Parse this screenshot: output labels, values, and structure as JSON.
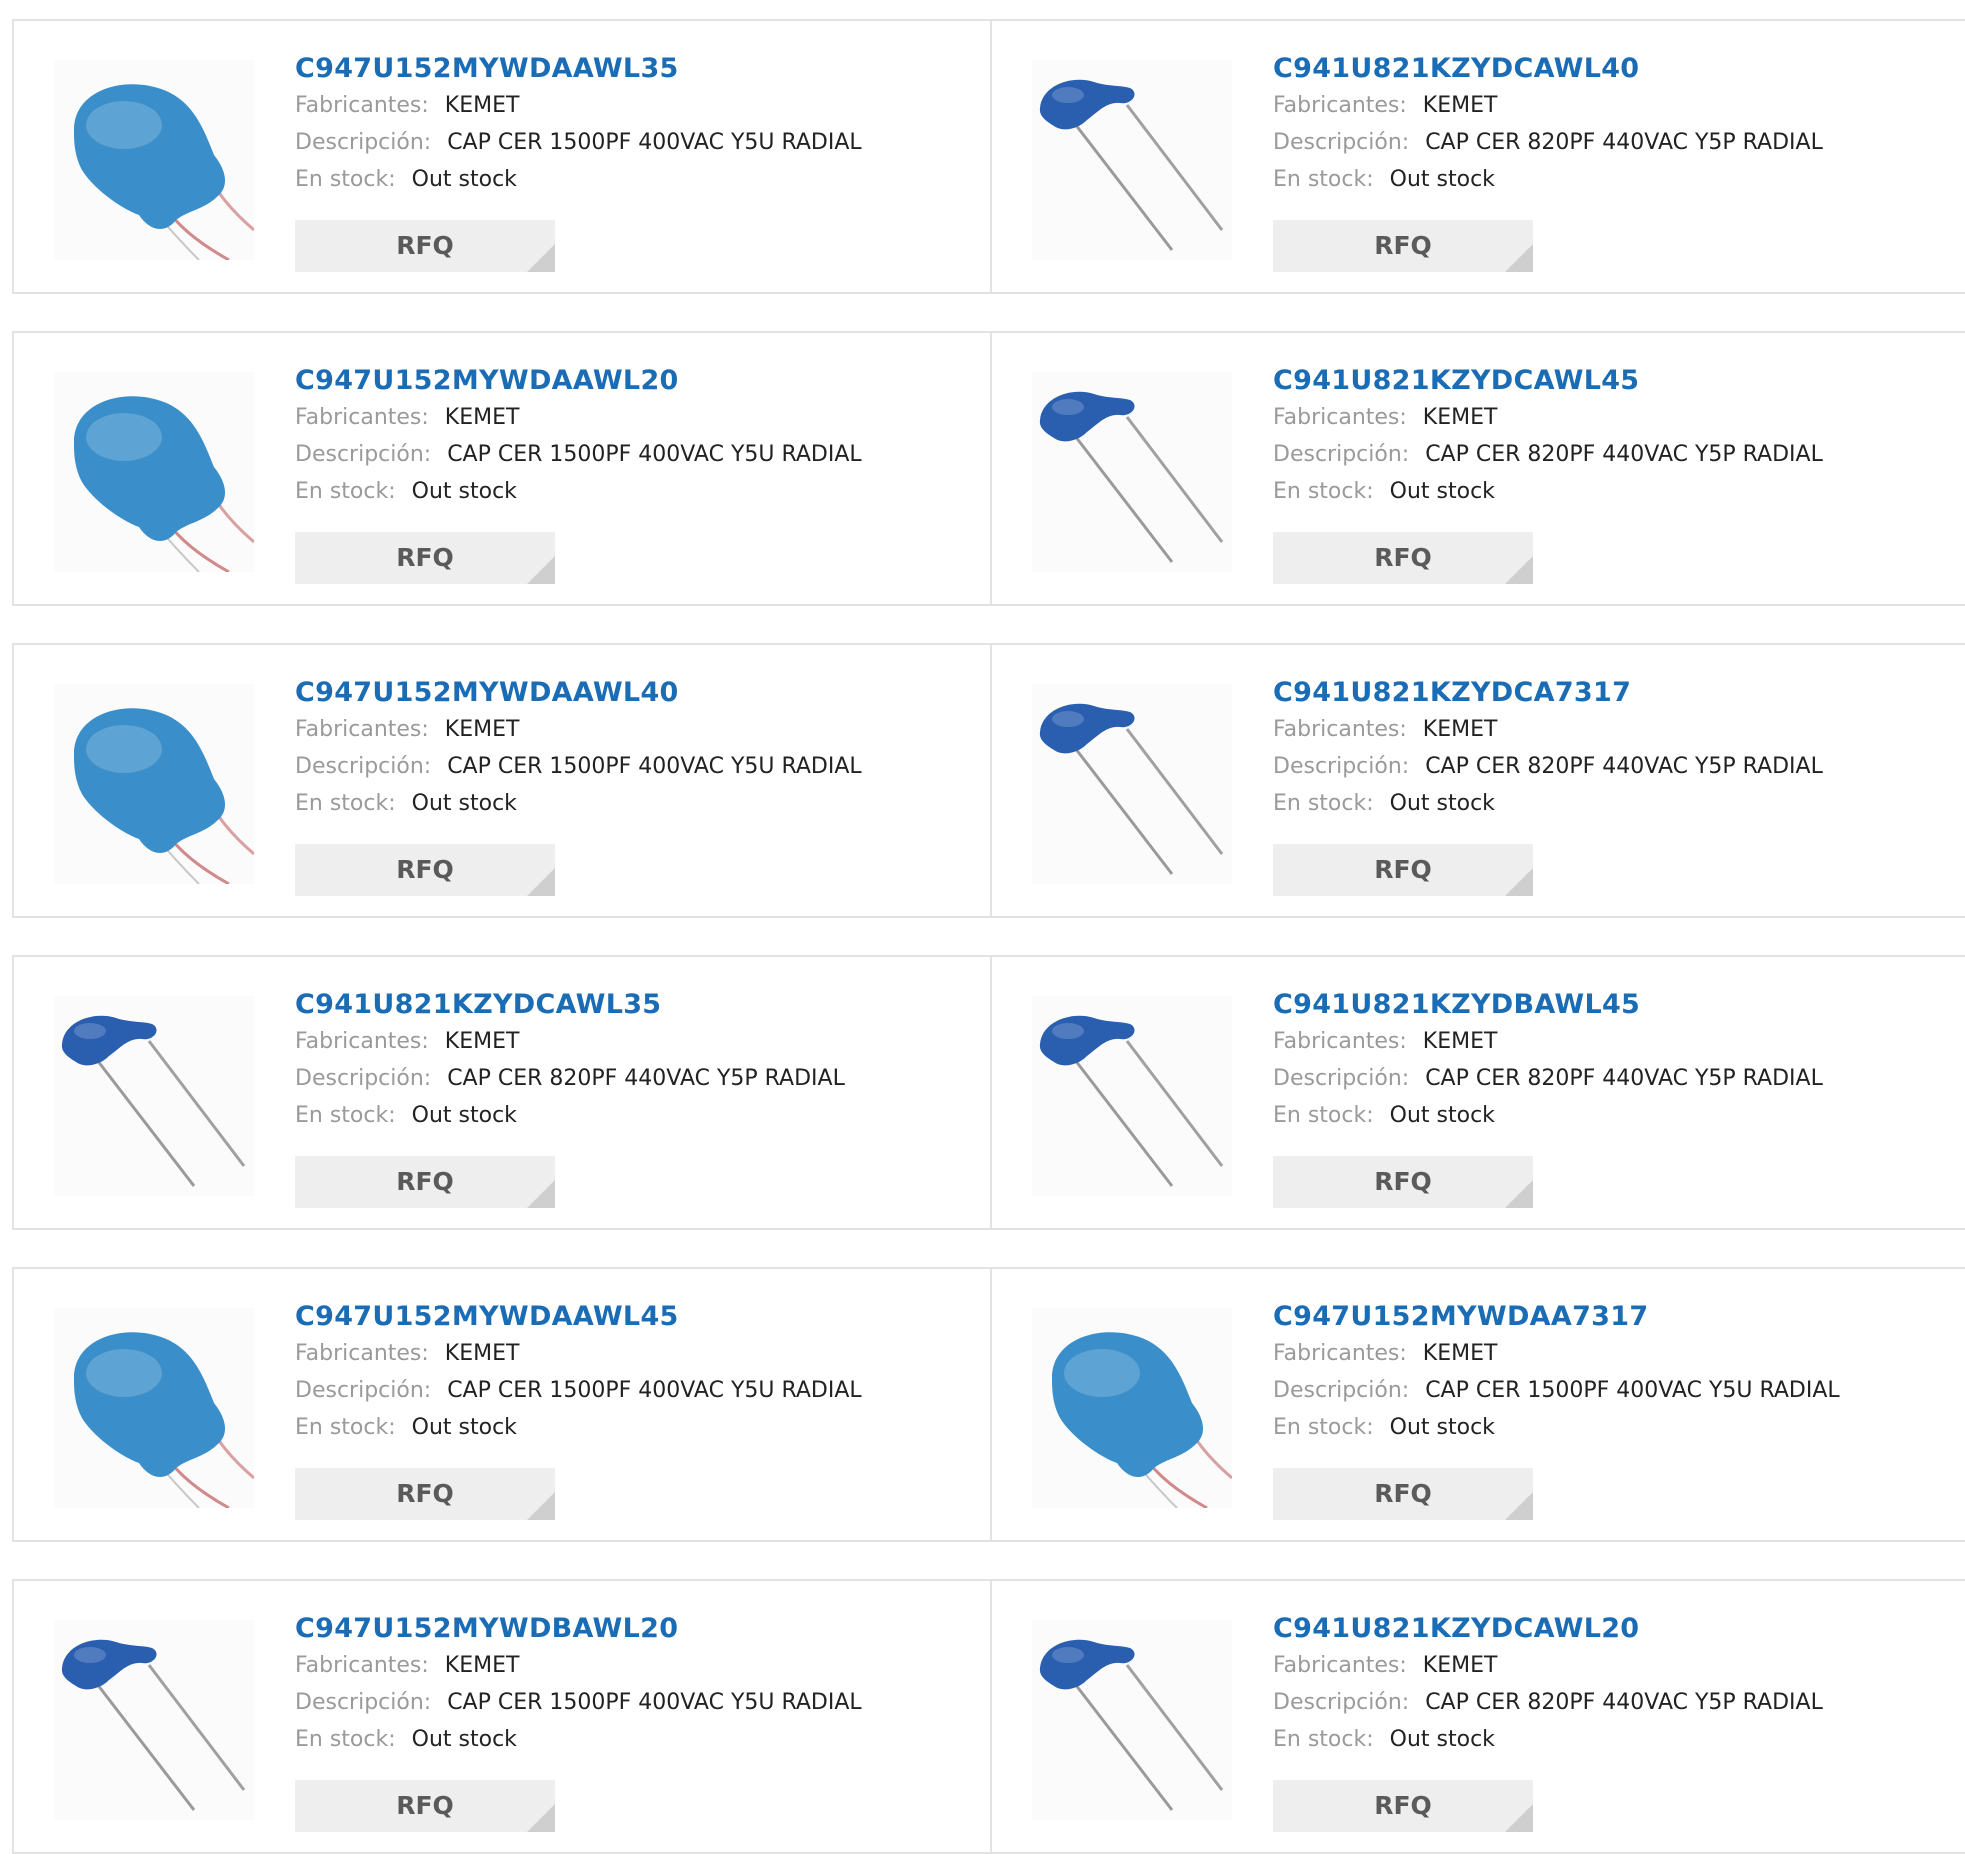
{
  "labels": {
    "manufacturer": "Fabricantes:",
    "description": "Descripción:",
    "stock": "En stock:",
    "rfq": "RFQ"
  },
  "colors": {
    "part_link": "#1a6db5",
    "capacitor_y5u": "#3a8fcb",
    "capacitor_y5p": "#2a5fb0",
    "border": "#e2e2e2"
  },
  "products": [
    {
      "part": "C947U152MYWDAAWL35",
      "manufacturer": "KEMET",
      "description": "CAP CER 1500PF 400VAC Y5U RADIAL",
      "stock": "Out stock",
      "image": "disc-capacitor-large"
    },
    {
      "part": "C941U821KZYDCAWL40",
      "manufacturer": "KEMET",
      "description": "CAP CER 820PF 440VAC Y5P RADIAL",
      "stock": "Out stock",
      "image": "disc-capacitor-small"
    },
    {
      "part": "C947U152MYWDAAWL20",
      "manufacturer": "KEMET",
      "description": "CAP CER 1500PF 400VAC Y5U RADIAL",
      "stock": "Out stock",
      "image": "disc-capacitor-large"
    },
    {
      "part": "C941U821KZYDCAWL45",
      "manufacturer": "KEMET",
      "description": "CAP CER 820PF 440VAC Y5P RADIAL",
      "stock": "Out stock",
      "image": "disc-capacitor-small"
    },
    {
      "part": "C947U152MYWDAAWL40",
      "manufacturer": "KEMET",
      "description": "CAP CER 1500PF 400VAC Y5U RADIAL",
      "stock": "Out stock",
      "image": "disc-capacitor-large"
    },
    {
      "part": "C941U821KZYDCA7317",
      "manufacturer": "KEMET",
      "description": "CAP CER 820PF 440VAC Y5P RADIAL",
      "stock": "Out stock",
      "image": "disc-capacitor-small"
    },
    {
      "part": "C941U821KZYDCAWL35",
      "manufacturer": "KEMET",
      "description": "CAP CER 820PF 440VAC Y5P RADIAL",
      "stock": "Out stock",
      "image": "disc-capacitor-small"
    },
    {
      "part": "C941U821KZYDBAWL45",
      "manufacturer": "KEMET",
      "description": "CAP CER 820PF 440VAC Y5P RADIAL",
      "stock": "Out stock",
      "image": "disc-capacitor-small"
    },
    {
      "part": "C947U152MYWDAAWL45",
      "manufacturer": "KEMET",
      "description": "CAP CER 1500PF 400VAC Y5U RADIAL",
      "stock": "Out stock",
      "image": "disc-capacitor-large"
    },
    {
      "part": "C947U152MYWDAA7317",
      "manufacturer": "KEMET",
      "description": "CAP CER 1500PF 400VAC Y5U RADIAL",
      "stock": "Out stock",
      "image": "disc-capacitor-large"
    },
    {
      "part": "C947U152MYWDBAWL20",
      "manufacturer": "KEMET",
      "description": "CAP CER 1500PF 400VAC Y5U RADIAL",
      "stock": "Out stock",
      "image": "disc-capacitor-small"
    },
    {
      "part": "C941U821KZYDCAWL20",
      "manufacturer": "KEMET",
      "description": "CAP CER 820PF 440VAC Y5P RADIAL",
      "stock": "Out stock",
      "image": "disc-capacitor-small"
    }
  ]
}
